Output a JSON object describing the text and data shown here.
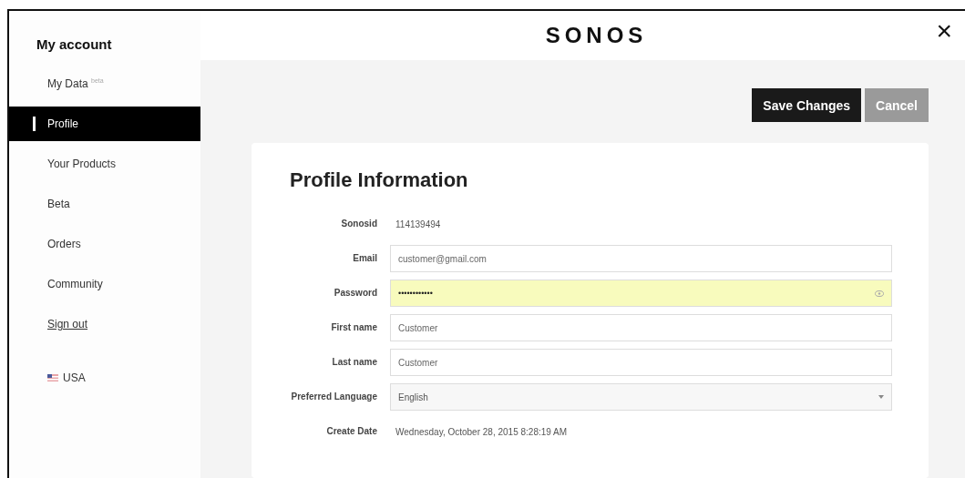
{
  "sidebar": {
    "title": "My account",
    "items": [
      {
        "label": "My Data $^{beta}$",
        "selected": false,
        "kind": "link"
      },
      {
        "label": "Profile",
        "selected": true,
        "kind": "link"
      },
      {
        "label": "Your Products",
        "selected": false,
        "kind": "link"
      },
      {
        "label": "Beta",
        "selected": false,
        "kind": "link"
      },
      {
        "label": "Orders",
        "selected": false,
        "kind": "link"
      },
      {
        "label": "Community",
        "selected": false,
        "kind": "link"
      },
      {
        "label": "Sign out",
        "selected": false,
        "kind": "underlined"
      }
    ],
    "region": "USA"
  },
  "header": {
    "logo": "SONOS",
    "close": "×"
  },
  "buttons": [
    {
      "label": "Save Changes",
      "disabled": false
    },
    {
      "label": "Cancel",
      "disabled": true
    }
  ],
  "profile": {
    "title": "Profile Information",
    "fields": [
      {
        "label": "Sonosid",
        "kind": "text",
        "value": "114139494"
      },
      {
        "label": "Email",
        "kind": "input",
        "value": "customer@gmail.com",
        "highlighted": false
      },
      {
        "label": "Password",
        "kind": "password",
        "value": "••••••••••••",
        "highlighted": true
      },
      {
        "label": "First name",
        "kind": "input",
        "value": "Customer",
        "highlighted": false
      },
      {
        "label": "Last name",
        "kind": "input",
        "value": "Customer",
        "highlighted": false
      },
      {
        "label": "Preferred Language",
        "kind": "select",
        "value": "English"
      },
      {
        "label": "Create Date",
        "kind": "text",
        "value": "Wednesday, October 28, 2015 8:28:19 AM"
      }
    ]
  }
}
